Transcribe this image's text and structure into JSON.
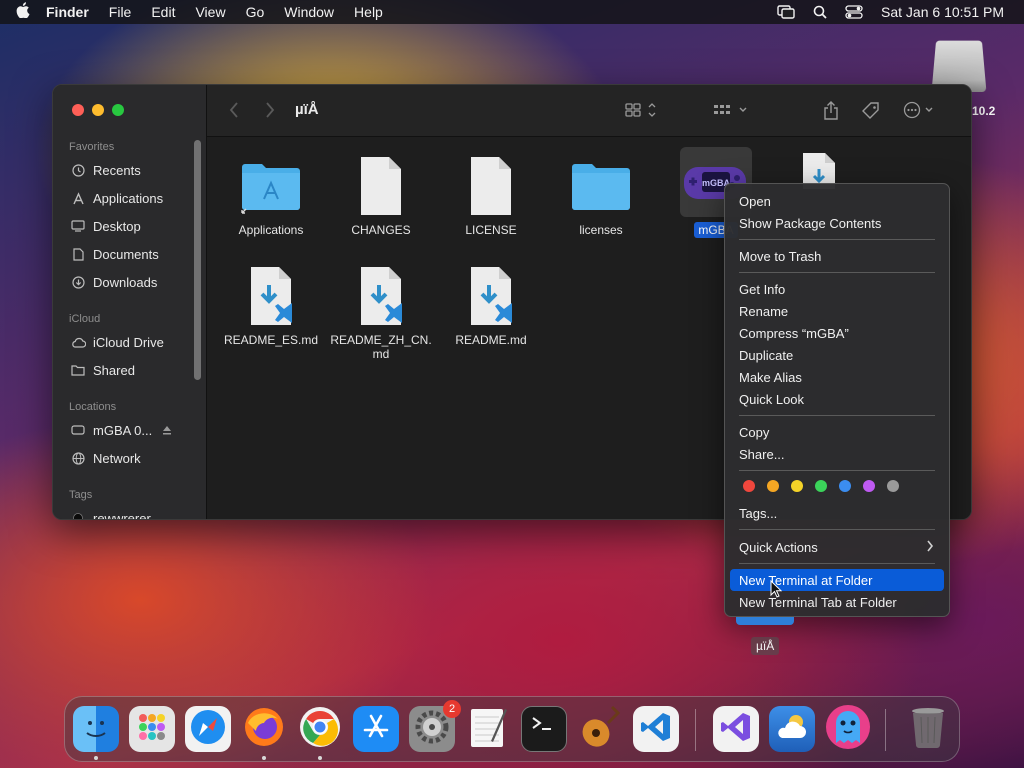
{
  "menubar": {
    "apple": "",
    "items": [
      "Finder",
      "File",
      "Edit",
      "View",
      "Go",
      "Window",
      "Help"
    ],
    "clock": "Sat Jan 6  10:51 PM",
    "icons": [
      "screen-mirroring-icon",
      "spotlight-search-icon",
      "control-center-icon"
    ]
  },
  "desktop": {
    "disk_label": "10.2",
    "selected_item_label": "µïÅ"
  },
  "finder": {
    "title": "µïÅ",
    "sidebar": {
      "favorites_header": "Favorites",
      "favorites": [
        {
          "label": "Recents",
          "icon": "clock-icon"
        },
        {
          "label": "Applications",
          "icon": "applications-icon"
        },
        {
          "label": "Desktop",
          "icon": "desktop-icon"
        },
        {
          "label": "Documents",
          "icon": "document-icon"
        },
        {
          "label": "Downloads",
          "icon": "download-icon"
        }
      ],
      "icloud_header": "iCloud",
      "icloud": [
        {
          "label": "iCloud Drive",
          "icon": "cloud-icon"
        },
        {
          "label": "Shared",
          "icon": "shared-folder-icon"
        }
      ],
      "locations_header": "Locations",
      "locations": [
        {
          "label": "mGBA 0...",
          "icon": "disk-icon"
        },
        {
          "label": "Network",
          "icon": "globe-icon"
        }
      ],
      "tags_header": "Tags",
      "tags": [
        {
          "label": "rewwrerer",
          "icon": "tag-dot-icon"
        }
      ]
    },
    "files": [
      {
        "name": "Applications",
        "kind": "app-folder"
      },
      {
        "name": "CHANGES",
        "kind": "doc"
      },
      {
        "name": "LICENSE",
        "kind": "doc"
      },
      {
        "name": "licenses",
        "kind": "folder"
      },
      {
        "name": "mGBA",
        "kind": "app"
      },
      {
        "name": "",
        "kind": "vscode-md"
      },
      {
        "name": "README_ES.md",
        "kind": "vscode-md"
      },
      {
        "name": "README_ZH_CN.md",
        "kind": "vscode-md"
      },
      {
        "name": "README.md",
        "kind": "vscode-md"
      }
    ],
    "files_display": {
      "zh_line1": "README_ZH_CN.",
      "zh_line2": "md"
    }
  },
  "context_menu": {
    "groups": [
      [
        "Open",
        "Show Package Contents"
      ],
      [
        "Move to Trash"
      ],
      [
        "Get Info",
        "Rename",
        "Compress “mGBA”",
        "Duplicate",
        "Make Alias",
        "Quick Look"
      ],
      [
        "Copy",
        "Share..."
      ]
    ],
    "tag_colors": [
      "#f0473d",
      "#f5a623",
      "#f5d328",
      "#3bd35a",
      "#3b8df0",
      "#bf5af2",
      "#9a9a9a"
    ],
    "tags_label": "Tags...",
    "quick_actions": "Quick Actions",
    "new_terminal": "New Terminal at Folder",
    "new_terminal_tab": "New Terminal Tab at Folder",
    "highlighted": "New Terminal at Folder"
  },
  "dock": {
    "apps": [
      {
        "name": "finder",
        "icon": "finder-icon",
        "running": true
      },
      {
        "name": "launchpad",
        "icon": "launchpad-icon",
        "running": false
      },
      {
        "name": "safari",
        "icon": "safari-icon",
        "running": false
      },
      {
        "name": "firefox",
        "icon": "firefox-icon",
        "running": true
      },
      {
        "name": "chrome",
        "icon": "chrome-icon",
        "running": true
      },
      {
        "name": "app-store",
        "icon": "app-store-icon",
        "running": false
      },
      {
        "name": "system-settings",
        "icon": "settings-gear-icon",
        "running": false,
        "badge": "2"
      },
      {
        "name": "textedit",
        "icon": "textedit-icon",
        "running": false
      },
      {
        "name": "terminal",
        "icon": "terminal-icon",
        "running": false
      },
      {
        "name": "garageband",
        "icon": "guitar-icon",
        "running": false
      },
      {
        "name": "vscode",
        "icon": "vscode-icon",
        "running": false
      },
      {
        "name": "visual-studio",
        "icon": "visual-studio-icon",
        "running": false
      },
      {
        "name": "weather",
        "icon": "weather-icon",
        "running": false
      },
      {
        "name": "ghost-app",
        "icon": "ghost-app-icon",
        "running": false
      },
      {
        "name": "trash",
        "icon": "trash-icon",
        "running": false
      }
    ]
  }
}
